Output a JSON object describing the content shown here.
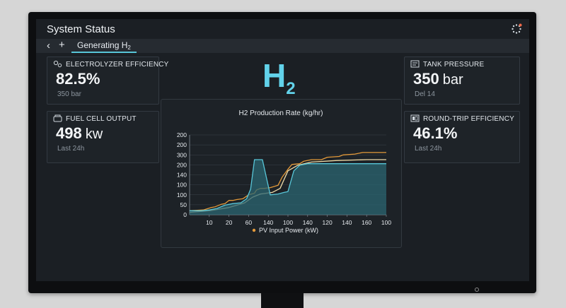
{
  "header": {
    "title": "System Status"
  },
  "tabs": [
    {
      "label": "Generating H",
      "subscript": "2"
    }
  ],
  "cards": {
    "electrolyzer": {
      "label": "ELECTROLYZER EFFICIENCY",
      "value": "82.5%",
      "unit": "",
      "sub": "350 bar"
    },
    "fuel_cell": {
      "label": "FUEL CELL OUTPUT",
      "value": "498",
      "unit": "kw",
      "sub": "Last 24h"
    },
    "tank_pressure": {
      "label": "TANK PRESSURE",
      "value": "350",
      "unit": "bar",
      "sub": "Del 14"
    },
    "round_trip": {
      "label": "ROUND-TRIP EFFICIENCY",
      "value": "46.1%",
      "unit": "",
      "sub": "Last 24h"
    }
  },
  "logo": {
    "symbol": "H",
    "subscript": "2"
  },
  "colors": {
    "cyan": "#58c6d8",
    "orange": "#e49a3a",
    "fill": "#2b6672"
  },
  "chart_data": {
    "type": "line",
    "title": "H2 Production Rate (kg/hr)",
    "xlabel": "",
    "ylabel": "",
    "x_tick_labels": [
      "10",
      "20",
      "60",
      "140",
      "100",
      "140",
      "120",
      "140",
      "160",
      "100"
    ],
    "y_tick_labels": [
      "0",
      "50",
      "100",
      "100",
      "140",
      "200",
      "300",
      "200",
      "200"
    ],
    "legend": [
      {
        "label": "PV Input Power (kW)",
        "color": "#e49a3a"
      }
    ],
    "series": [
      {
        "color": "#e49a3a",
        "values": [
          [
            0,
            0.05
          ],
          [
            0.07,
            0.06
          ],
          [
            0.11,
            0.09
          ],
          [
            0.13,
            0.1
          ],
          [
            0.16,
            0.13
          ],
          [
            0.18,
            0.14
          ],
          [
            0.2,
            0.18
          ],
          [
            0.22,
            0.18
          ],
          [
            0.24,
            0.19
          ],
          [
            0.27,
            0.2
          ],
          [
            0.3,
            0.25
          ],
          [
            0.33,
            0.27
          ],
          [
            0.34,
            0.31
          ],
          [
            0.36,
            0.33
          ],
          [
            0.38,
            0.33
          ],
          [
            0.41,
            0.34
          ],
          [
            0.45,
            0.37
          ],
          [
            0.47,
            0.47
          ],
          [
            0.5,
            0.57
          ],
          [
            0.52,
            0.63
          ],
          [
            0.56,
            0.64
          ],
          [
            0.58,
            0.67
          ],
          [
            0.62,
            0.69
          ],
          [
            0.67,
            0.69
          ],
          [
            0.7,
            0.72
          ],
          [
            0.76,
            0.73
          ],
          [
            0.78,
            0.75
          ],
          [
            0.84,
            0.76
          ],
          [
            0.88,
            0.78
          ],
          [
            1,
            0.78
          ]
        ]
      },
      {
        "color": "#f0dca8",
        "values": [
          [
            0,
            0.03
          ],
          [
            0.1,
            0.05
          ],
          [
            0.2,
            0.09
          ],
          [
            0.28,
            0.15
          ],
          [
            0.32,
            0.22
          ],
          [
            0.36,
            0.26
          ],
          [
            0.42,
            0.28
          ],
          [
            0.46,
            0.33
          ],
          [
            0.5,
            0.55
          ],
          [
            0.55,
            0.62
          ],
          [
            0.62,
            0.66
          ],
          [
            0.75,
            0.68
          ],
          [
            0.9,
            0.69
          ],
          [
            1,
            0.69
          ]
        ]
      },
      {
        "color": "#58c6d8",
        "fill": "#2b6672",
        "values": [
          [
            0,
            0.05
          ],
          [
            0.06,
            0.05
          ],
          [
            0.1,
            0.06
          ],
          [
            0.14,
            0.08
          ],
          [
            0.18,
            0.12
          ],
          [
            0.22,
            0.14
          ],
          [
            0.26,
            0.15
          ],
          [
            0.29,
            0.2
          ],
          [
            0.31,
            0.32
          ],
          [
            0.33,
            0.69
          ],
          [
            0.37,
            0.69
          ],
          [
            0.41,
            0.25
          ],
          [
            0.45,
            0.26
          ],
          [
            0.48,
            0.28
          ],
          [
            0.5,
            0.29
          ],
          [
            0.53,
            0.55
          ],
          [
            0.56,
            0.62
          ],
          [
            0.6,
            0.64
          ],
          [
            0.68,
            0.64
          ],
          [
            1,
            0.64
          ]
        ]
      }
    ]
  }
}
